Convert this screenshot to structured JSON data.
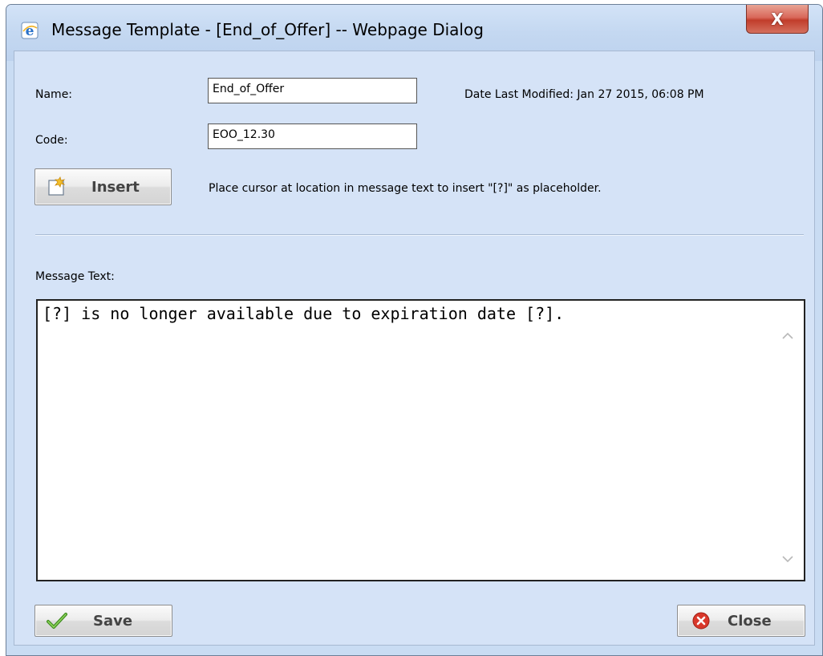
{
  "window": {
    "title": "Message Template - [End_of_Offer] -- Webpage Dialog",
    "close_label": "X"
  },
  "form": {
    "name_label": "Name:",
    "name_value": "End_of_Offer",
    "date_modified": "Date Last Modified: Jan 27 2015, 06:08 PM",
    "code_label": "Code:",
    "code_value": "EOO_12.30",
    "insert_label": "Insert",
    "insert_hint": "Place cursor at location in message text to insert \"[?]\" as placeholder.",
    "message_label": "Message Text:",
    "message_text": "[?] is no longer available due to expiration date [?]."
  },
  "footer": {
    "save_label": "Save",
    "close_label": "Close"
  },
  "colors": {
    "client_bg": "#d5e3f7",
    "titlebar_bg": "#c4d8f1",
    "close_red": "#c13d2b"
  }
}
